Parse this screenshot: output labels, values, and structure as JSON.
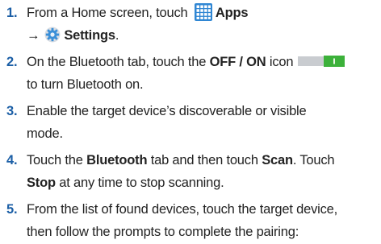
{
  "steps": [
    {
      "num": "1.",
      "line1_a": "From a Home screen, touch ",
      "apps_label": "Apps",
      "arrow": "→",
      "settings_label": "Settings",
      "settings_end": "."
    },
    {
      "num": "2.",
      "a": "On the Bluetooth tab, touch the ",
      "off_on": "OFF / ON",
      "b": " icon",
      "line2": "to turn Bluetooth on."
    },
    {
      "num": "3.",
      "line1": "Enable the target device’s discoverable or visible",
      "line2": "mode."
    },
    {
      "num": "4.",
      "a": "Touch the ",
      "bluetooth": "Bluetooth",
      "b": " tab and then touch ",
      "scan": "Scan",
      "c": ". Touch",
      "stop": "Stop",
      "d": " at any time to stop scanning."
    },
    {
      "num": "5.",
      "line1": "From the list of found devices, touch the target device,",
      "line2": "then follow the prompts to complete the pairing:"
    }
  ],
  "colors": {
    "number": "#1c5fa6",
    "apps_icon": "#2f86d3",
    "toggle_on": "#3cb13a"
  }
}
